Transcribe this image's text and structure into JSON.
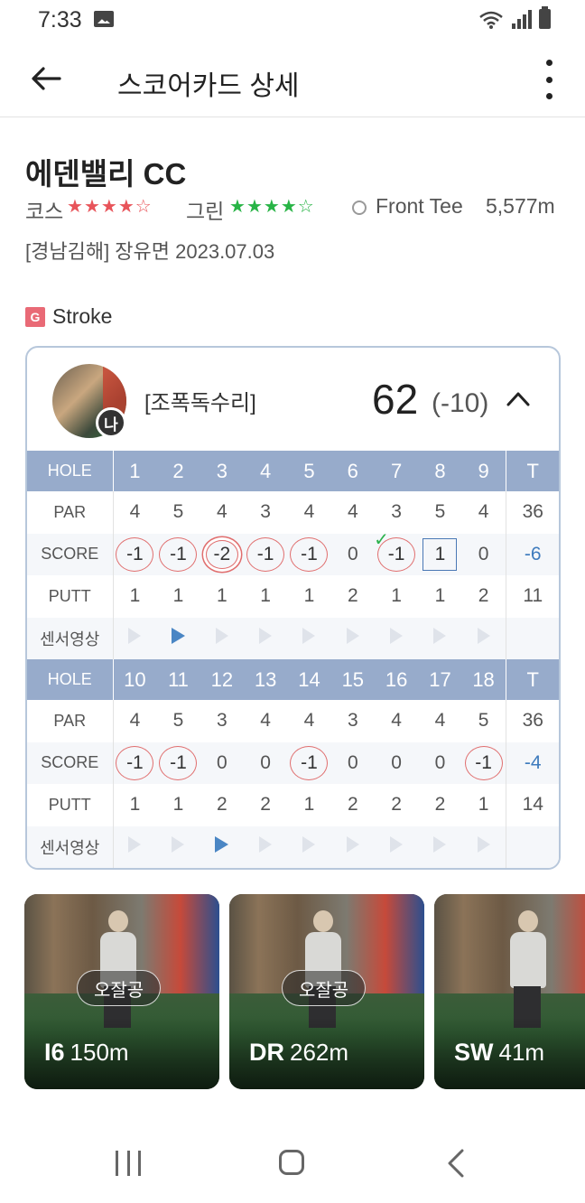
{
  "status": {
    "time": "7:33"
  },
  "header": {
    "title": "스코어카드 상세"
  },
  "course": {
    "name": "에덴밸리 CC",
    "course_label": "코스",
    "course_stars": 4,
    "green_label": "그린",
    "green_stars": 4,
    "tee": "Front Tee",
    "distance": "5,577m",
    "info": "[경남김해] 장유면 2023.07.03"
  },
  "mode": {
    "badge": "G",
    "label": "Stroke"
  },
  "player": {
    "badge": "나",
    "nickname": "[조폭독수리]",
    "total": "62",
    "diff": "(-10)"
  },
  "scorecard": {
    "labels": {
      "hole": "HOLE",
      "par": "PAR",
      "score": "SCORE",
      "putt": "PUTT",
      "video": "센서영상",
      "total": "T"
    },
    "front": {
      "holes": [
        "1",
        "2",
        "3",
        "4",
        "5",
        "6",
        "7",
        "8",
        "9"
      ],
      "par": [
        "4",
        "5",
        "4",
        "3",
        "4",
        "4",
        "3",
        "5",
        "4"
      ],
      "par_total": "36",
      "score": [
        "-1",
        "-1",
        "-2",
        "-1",
        "-1",
        "0",
        "-1",
        "1",
        "0"
      ],
      "score_total": "-6",
      "putt": [
        "1",
        "1",
        "1",
        "1",
        "1",
        "2",
        "1",
        "1",
        "2"
      ],
      "putt_total": "11"
    },
    "back": {
      "holes": [
        "10",
        "11",
        "12",
        "13",
        "14",
        "15",
        "16",
        "17",
        "18"
      ],
      "par": [
        "4",
        "5",
        "3",
        "4",
        "4",
        "3",
        "4",
        "4",
        "5"
      ],
      "par_total": "36",
      "score": [
        "-1",
        "-1",
        "0",
        "0",
        "-1",
        "0",
        "0",
        "0",
        "-1"
      ],
      "score_total": "-4",
      "putt": [
        "1",
        "1",
        "2",
        "2",
        "1",
        "2",
        "2",
        "2",
        "1"
      ],
      "putt_total": "14"
    }
  },
  "shots": [
    {
      "tag": "오잘공",
      "club": "I6",
      "distance": "150m"
    },
    {
      "tag": "오잘공",
      "club": "DR",
      "distance": "262m"
    },
    {
      "tag": "",
      "club": "SW",
      "distance": "41m"
    }
  ],
  "colors": {
    "accent": "#97abcb",
    "bogey_circle": "#e06e6e",
    "birdie_square": "#4a78b5",
    "star_course": "#e8545a",
    "star_green": "#28b446",
    "total_score": "#3e7bbd"
  }
}
